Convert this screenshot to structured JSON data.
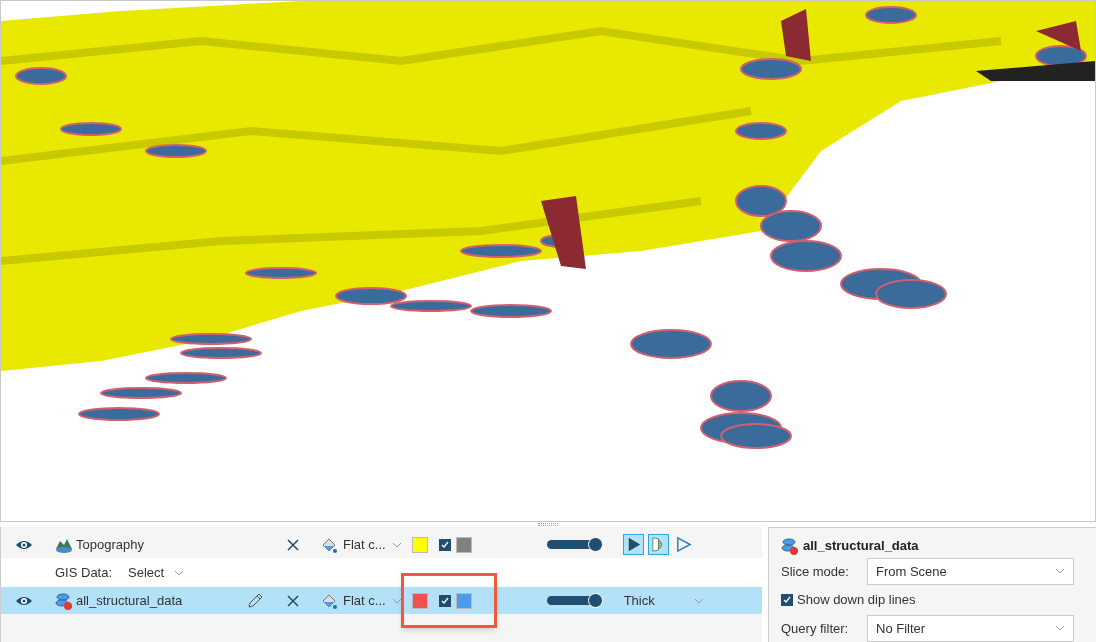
{
  "layers": [
    {
      "kind": "object",
      "name": "Topography",
      "visible": true,
      "selected": false,
      "editable": false,
      "color_mode": "Flat c...",
      "color": "#ffff00",
      "back_face": {
        "checked": true,
        "color": "#808080"
      },
      "opacity": {
        "level": 0.92
      },
      "display": {
        "kind": "buttons",
        "buttons": [
          {
            "selected": true
          },
          {
            "selected": true
          },
          {
            "selected": false
          }
        ]
      }
    },
    {
      "kind": "gis",
      "label": "GIS Data:",
      "value": "Select"
    },
    {
      "kind": "object",
      "name": "all_structural_data",
      "visible": true,
      "selected": true,
      "editable": true,
      "warning": true,
      "color_mode": "Flat c...",
      "color": "#ef5350",
      "back_face": {
        "checked": true,
        "color": "#4a9be8"
      },
      "opacity": {
        "level": 0.92
      },
      "display": {
        "kind": "dropdown",
        "value": "Thick"
      }
    }
  ],
  "properties": {
    "title": "all_structural_data",
    "slice_mode": {
      "label": "Slice mode:",
      "value": "From Scene"
    },
    "down_dip": {
      "label": "Show down dip lines",
      "checked": true
    },
    "query_filter": {
      "label": "Query filter:",
      "value": "No Filter"
    }
  }
}
